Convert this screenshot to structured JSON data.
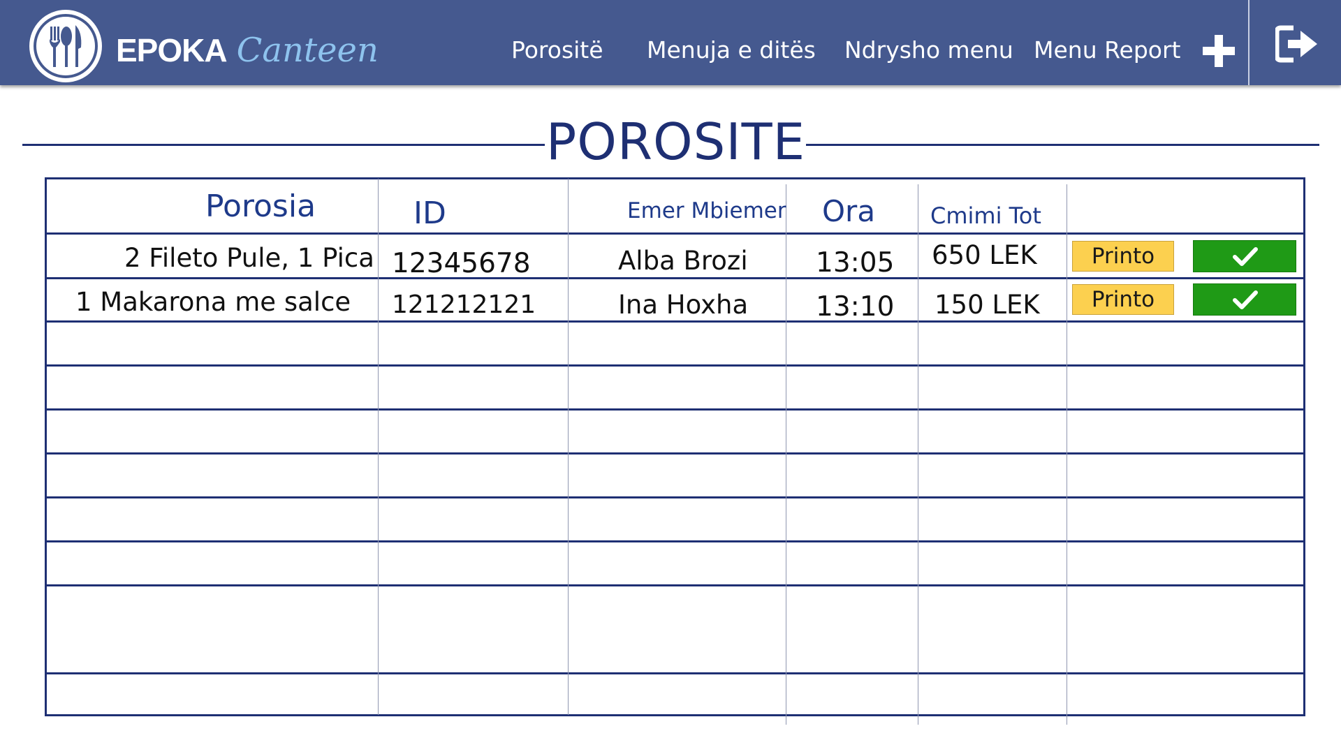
{
  "app": {
    "brand_main": "EPOKA",
    "brand_sub": "Canteen"
  },
  "nav": {
    "items": [
      {
        "label": "Porositë"
      },
      {
        "label": "Menuja e ditës"
      },
      {
        "label": "Ndrysho menu"
      },
      {
        "label": "Menu Report"
      }
    ],
    "add_icon": "plus-icon",
    "logout_icon": "logout-icon"
  },
  "page": {
    "title": "POROSITE"
  },
  "table": {
    "headers": {
      "order": "Porosia",
      "id": "ID",
      "name": "Emer Mbiemer",
      "time": "Ora",
      "total": "Cmimi Tot"
    },
    "rows": [
      {
        "order": "2 Fileto Pule, 1 Pica",
        "id": "12345678",
        "name": "Alba Brozi",
        "time": "13:05",
        "total": "650 LEK",
        "print_label": "Printo"
      },
      {
        "order": "1 Makarona me salce",
        "id": "121212121",
        "name": "Ina Hoxha",
        "time": "13:10",
        "total": "150 LEK",
        "print_label": "Printo"
      }
    ],
    "empty_rows": 9
  },
  "colors": {
    "header_bg": "#45598f",
    "accent_navy": "#1e2f73",
    "print_button": "#fcd04f",
    "confirm_button": "#1f9a16",
    "brand_sub": "#8ec3ee"
  }
}
